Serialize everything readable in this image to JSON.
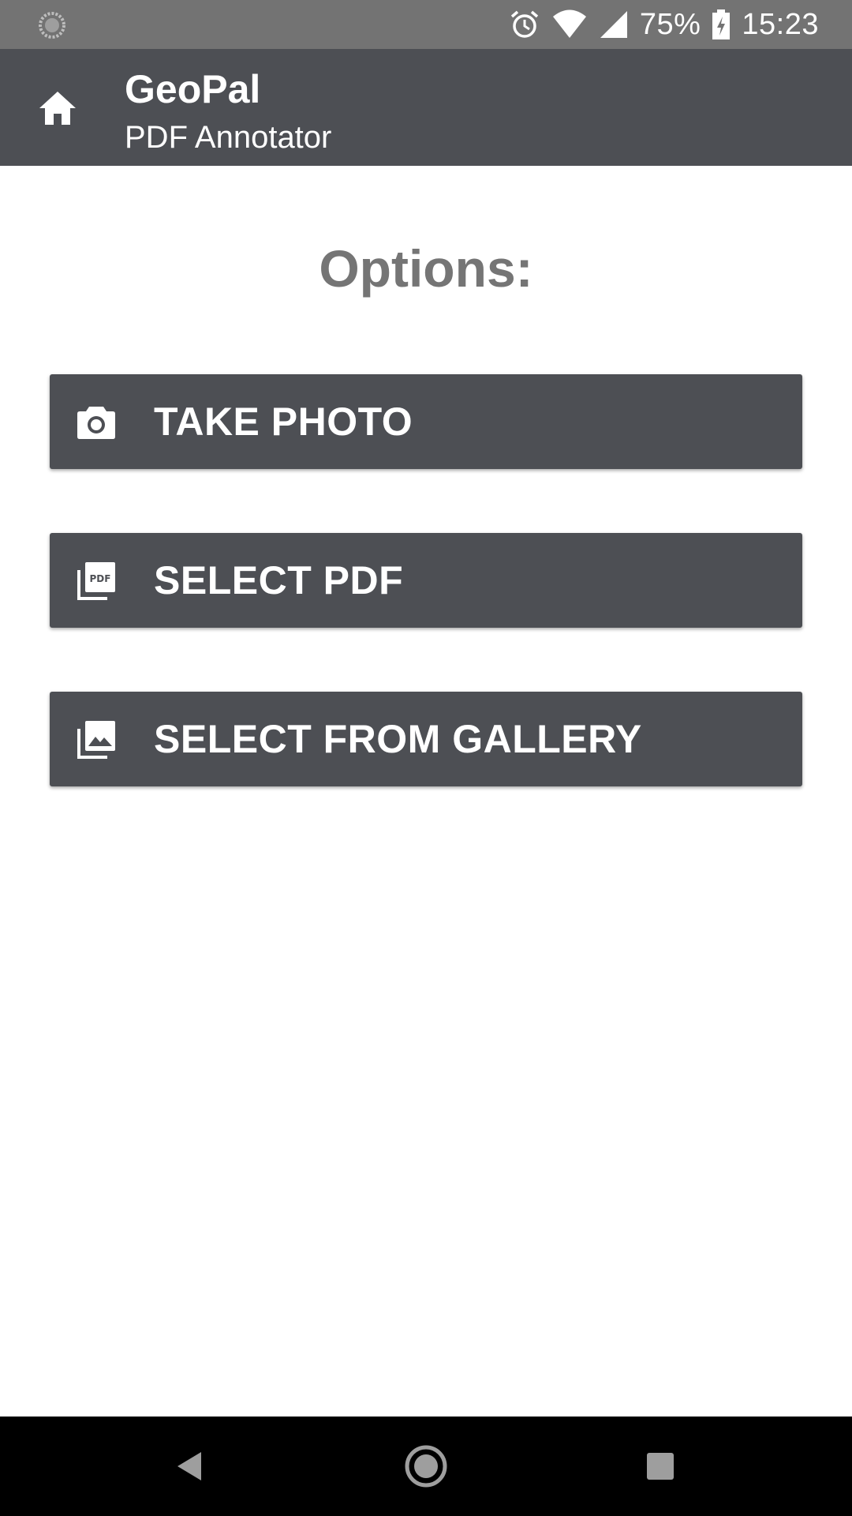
{
  "status_bar": {
    "battery_percent": "75%",
    "time": "15:23",
    "icons": [
      "sync-icon",
      "alarm-icon",
      "wifi-icon",
      "cell-signal-icon",
      "battery-charging-icon"
    ]
  },
  "app_bar": {
    "title": "GeoPal",
    "subtitle": "PDF Annotator",
    "icon": "home-icon"
  },
  "main": {
    "heading": "Options:",
    "buttons": [
      {
        "label": "TAKE PHOTO",
        "icon": "camera-icon"
      },
      {
        "label": "SELECT PDF",
        "icon": "pdf-icon"
      },
      {
        "label": "SELECT FROM GALLERY",
        "icon": "gallery-icon"
      }
    ]
  },
  "nav_bar": {
    "buttons": [
      "back-icon",
      "home-circle-icon",
      "recents-icon"
    ]
  },
  "colors": {
    "status_bar": "#737373",
    "app_bar": "#4d4f54",
    "button": "#4d4f54",
    "heading": "#757575",
    "nav_bar": "#000000"
  }
}
